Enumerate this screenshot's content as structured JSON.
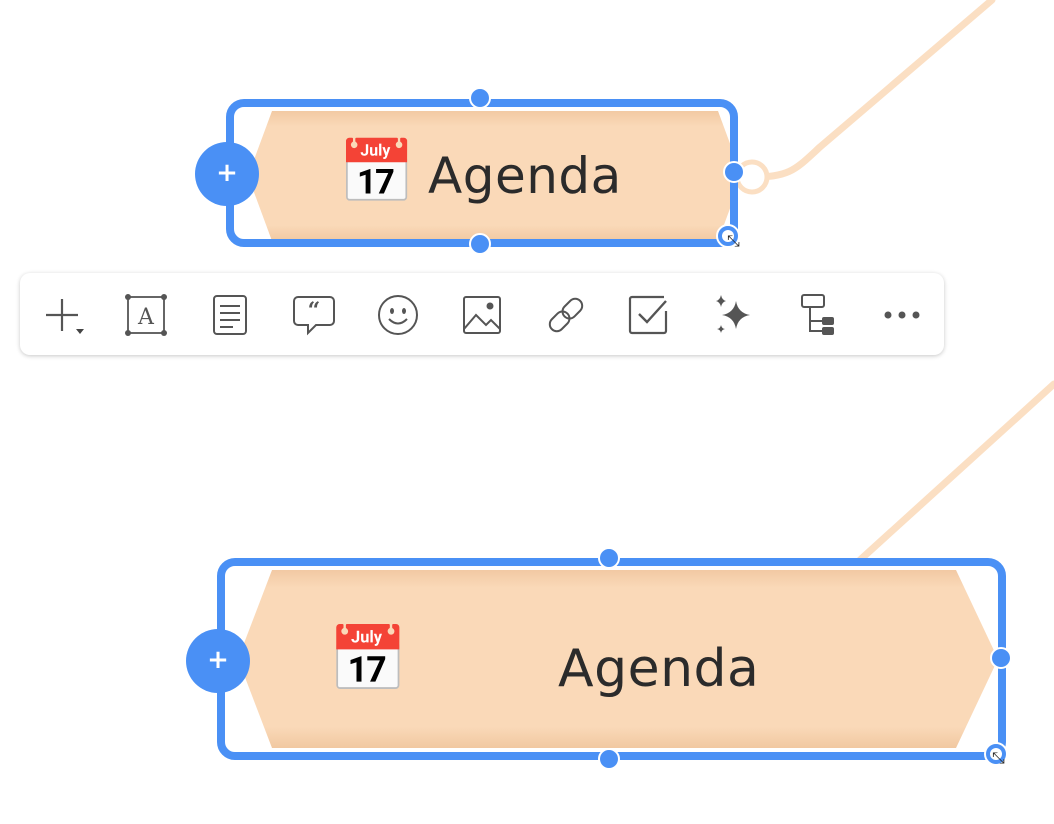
{
  "nodes": [
    {
      "label": "Agenda",
      "emoji": "📅"
    },
    {
      "label": "Agenda",
      "emoji": "📅"
    }
  ],
  "node_add_symbol": "+",
  "colors": {
    "selection": "#4a90f5",
    "node_fill": "#fad9b8",
    "node_fill_top": "#f3cfab",
    "connector": "#fbdfc3",
    "text": "#2b2b2b"
  },
  "toolbar": {
    "items": [
      {
        "icon": "add-icon",
        "label": "Add"
      },
      {
        "icon": "text-box-icon",
        "label": "Text"
      },
      {
        "icon": "note-icon",
        "label": "Note"
      },
      {
        "icon": "comment-icon",
        "label": "Comment"
      },
      {
        "icon": "emoji-icon",
        "label": "Emoji"
      },
      {
        "icon": "image-icon",
        "label": "Image"
      },
      {
        "icon": "link-icon",
        "label": "Link"
      },
      {
        "icon": "task-icon",
        "label": "Task"
      },
      {
        "icon": "ai-sparkle-icon",
        "label": "AI"
      },
      {
        "icon": "structure-icon",
        "label": "Structure"
      },
      {
        "icon": "more-icon",
        "label": "More"
      }
    ]
  }
}
